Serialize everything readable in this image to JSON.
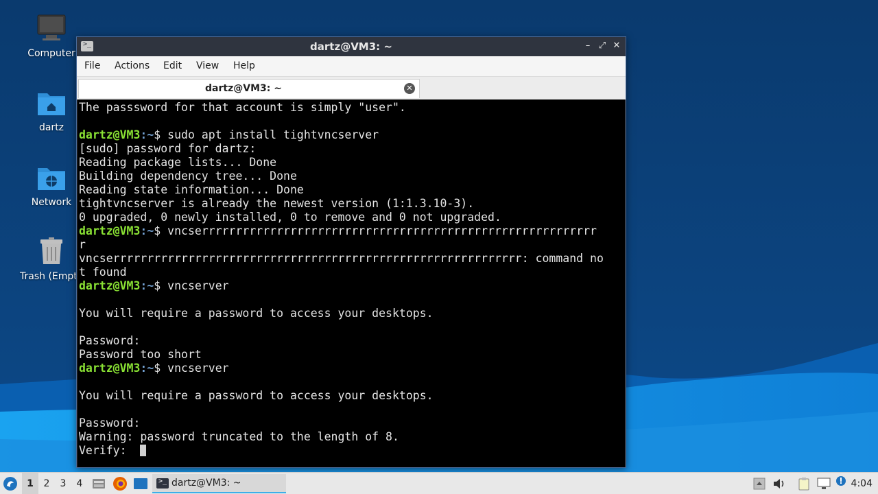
{
  "desktop": {
    "icons": [
      {
        "label": "Computer",
        "icon": "computer-icon"
      },
      {
        "label": "dartz",
        "icon": "home-folder-icon"
      },
      {
        "label": "Network",
        "icon": "network-folder-icon"
      },
      {
        "label": "Trash (Empt",
        "icon": "trash-icon"
      }
    ]
  },
  "window": {
    "title": "dartz@VM3: ~",
    "controls": {
      "minimize": "–",
      "maximize": "⤢",
      "close": "✕"
    },
    "menu": [
      "File",
      "Actions",
      "Edit",
      "View",
      "Help"
    ],
    "tab": {
      "title": "dartz@VM3: ~",
      "close": "✕"
    }
  },
  "terminal": {
    "prompt_user": "dartz@VM3",
    "prompt_path": ":~",
    "prompt_sym": "$ ",
    "lines": [
      {
        "type": "text",
        "text": "The passsword for that account is simply \"user\"."
      },
      {
        "type": "text",
        "text": ""
      },
      {
        "type": "prompt",
        "text": "sudo apt install tightvncserver"
      },
      {
        "type": "text",
        "text": "[sudo] password for dartz:"
      },
      {
        "type": "text",
        "text": "Reading package lists... Done"
      },
      {
        "type": "text",
        "text": "Building dependency tree... Done"
      },
      {
        "type": "text",
        "text": "Reading state information... Done"
      },
      {
        "type": "text",
        "text": "tightvncserver is already the newest version (1:1.3.10-3)."
      },
      {
        "type": "text",
        "text": "0 upgraded, 0 newly installed, 0 to remove and 0 not upgraded."
      },
      {
        "type": "prompt",
        "text": "vncserrrrrrrrrrrrrrrrrrrrrrrrrrrrrrrrrrrrrrrrrrrrrrrrrrrrrrrrrr"
      },
      {
        "type": "text",
        "text": "r"
      },
      {
        "type": "text",
        "text": "vncserrrrrrrrrrrrrrrrrrrrrrrrrrrrrrrrrrrrrrrrrrrrrrrrrrrrrrrrrrrr: command no"
      },
      {
        "type": "text",
        "text": "t found"
      },
      {
        "type": "prompt",
        "text": "vncserver"
      },
      {
        "type": "text",
        "text": ""
      },
      {
        "type": "text",
        "text": "You will require a password to access your desktops."
      },
      {
        "type": "text",
        "text": ""
      },
      {
        "type": "text",
        "text": "Password:"
      },
      {
        "type": "text",
        "text": "Password too short"
      },
      {
        "type": "prompt",
        "text": "vncserver"
      },
      {
        "type": "text",
        "text": ""
      },
      {
        "type": "text",
        "text": "You will require a password to access your desktops."
      },
      {
        "type": "text",
        "text": ""
      },
      {
        "type": "text",
        "text": "Password:"
      },
      {
        "type": "text",
        "text": "Warning: password truncated to the length of 8."
      },
      {
        "type": "cursor",
        "text": "Verify:  "
      }
    ]
  },
  "taskbar": {
    "start_icon": "lxqt-start-icon",
    "workspaces": [
      "1",
      "2",
      "3",
      "4"
    ],
    "active_workspace": "1",
    "launchers": [
      "file-manager-icon",
      "firefox-icon",
      "show-desktop-icon"
    ],
    "task_label": "dartz@VM3: ~",
    "tray": [
      "removable-media-icon",
      "volume-icon",
      "clipboard-icon",
      "network-icon",
      "update-notifier-icon"
    ],
    "clock": "4:04"
  },
  "colors": {
    "prompt_user": "#8ae234",
    "prompt_path": "#729fcf",
    "accent": "#3daee9"
  }
}
